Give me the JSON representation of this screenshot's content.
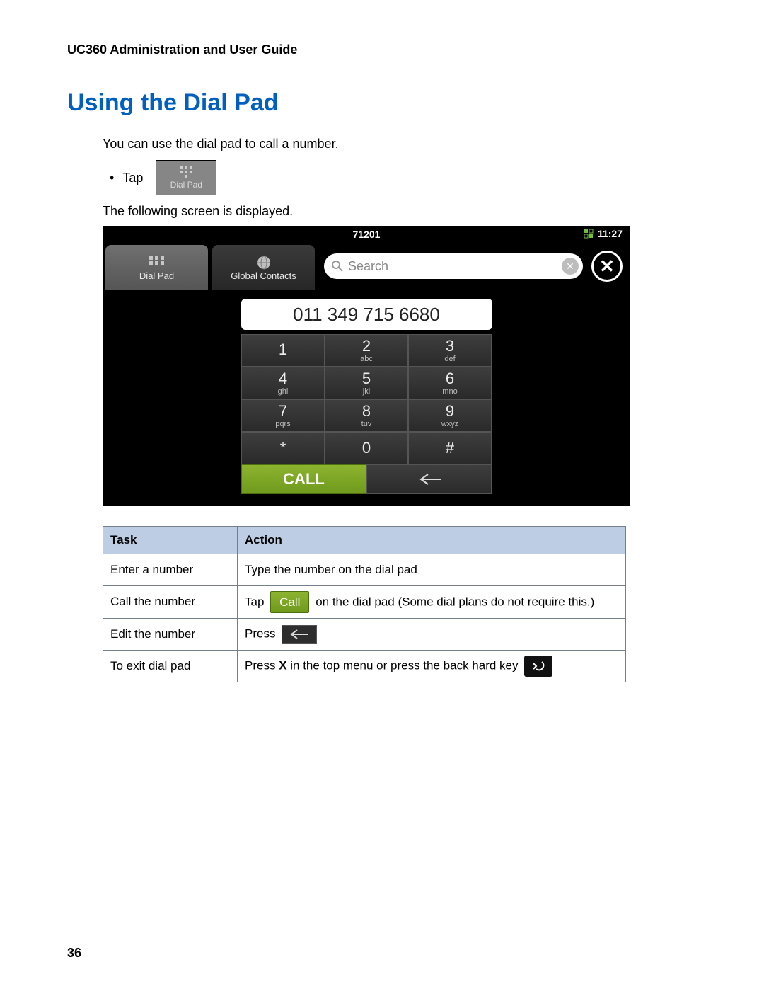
{
  "header": {
    "running_head": "UC360 Administration and User Guide"
  },
  "title": "Using the Dial Pad",
  "intro": "You can use the dial pad to call a number.",
  "bullet": {
    "tap": "Tap",
    "dialpad_label": "Dial Pad"
  },
  "followup": "The following screen is displayed.",
  "device": {
    "status_center": "71201",
    "status_time": "11:27",
    "tabs": {
      "dialpad": "Dial Pad",
      "contacts": "Global Contacts"
    },
    "search_placeholder": "Search",
    "display_number": "011 349 715 6680",
    "keys": [
      {
        "n": "1",
        "l": ""
      },
      {
        "n": "2",
        "l": "abc"
      },
      {
        "n": "3",
        "l": "def"
      },
      {
        "n": "4",
        "l": "ghi"
      },
      {
        "n": "5",
        "l": "jkl"
      },
      {
        "n": "6",
        "l": "mno"
      },
      {
        "n": "7",
        "l": "pqrs"
      },
      {
        "n": "8",
        "l": "tuv"
      },
      {
        "n": "9",
        "l": "wxyz"
      },
      {
        "n": "*",
        "l": ""
      },
      {
        "n": "0",
        "l": ""
      },
      {
        "n": "#",
        "l": ""
      }
    ],
    "call_label": "CALL"
  },
  "table": {
    "head": {
      "task": "Task",
      "action": "Action"
    },
    "rows": {
      "r1": {
        "task": "Enter a number",
        "action": "Type the number on the dial pad"
      },
      "r2": {
        "task": "Call the number",
        "pre": "Tap",
        "btn": "Call",
        "post": "on the dial pad (Some dial plans do not require this.)"
      },
      "r3": {
        "task": "Edit the number",
        "pre": "Press"
      },
      "r4": {
        "task": "To exit dial pad",
        "pre": "Press ",
        "bold": "X",
        "post": " in the top menu or press the back hard key"
      }
    }
  },
  "page_number": "36"
}
